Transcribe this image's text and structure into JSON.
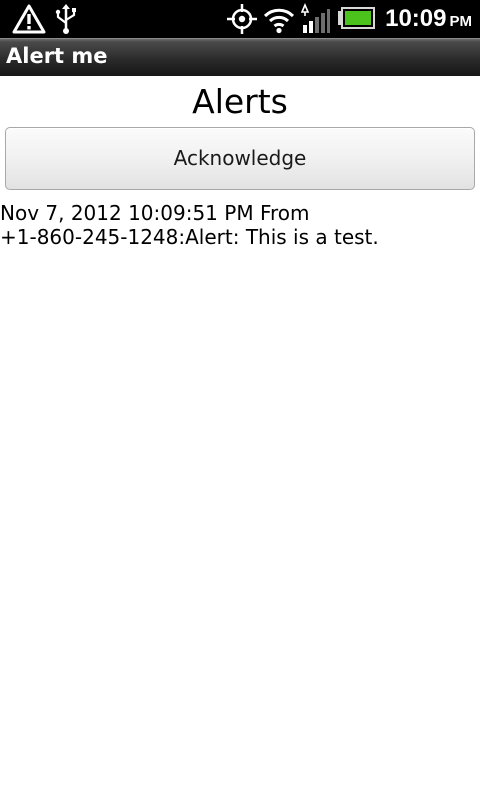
{
  "status_bar": {
    "icons": [
      "warning-icon",
      "usb-icon",
      "gps-icon",
      "wifi-icon",
      "signal-icon",
      "battery-icon"
    ],
    "time": "10:09",
    "ampm": "PM",
    "battery_color": "#4cc21c"
  },
  "title_bar": {
    "title": "Alert me"
  },
  "main": {
    "heading": "Alerts",
    "acknowledge_label": "Acknowledge",
    "alert_lines": [
      "Nov 7, 2012 10:09:51 PM From",
      "+1-860-245-1248:Alert: This is a test."
    ]
  }
}
